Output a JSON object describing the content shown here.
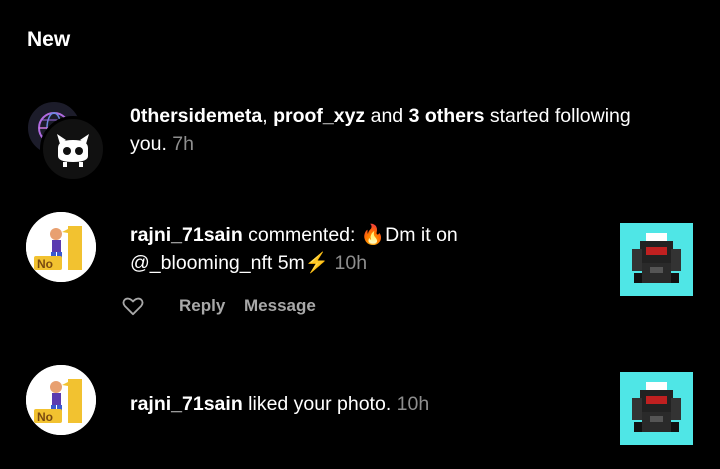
{
  "section": {
    "title": "New"
  },
  "notifications": [
    {
      "user1": "0thersidemeta",
      "sep1": ", ",
      "user2": "proof_xyz",
      "and": " and ",
      "others": "3 others",
      "action": " started following you.",
      "time": " 7h"
    },
    {
      "user": "rajni_71sain",
      "action": " commented: ",
      "fire_emoji": "🔥",
      "comment_text": "Dm it on @_blooming_nft 5m",
      "bolt_emoji": "⚡",
      "time": " 10h",
      "actions": {
        "reply": "Reply",
        "message": "Message"
      }
    },
    {
      "user": "rajni_71sain",
      "action": " liked your photo.",
      "time": " 10h"
    }
  ],
  "avatar_badge": "No"
}
